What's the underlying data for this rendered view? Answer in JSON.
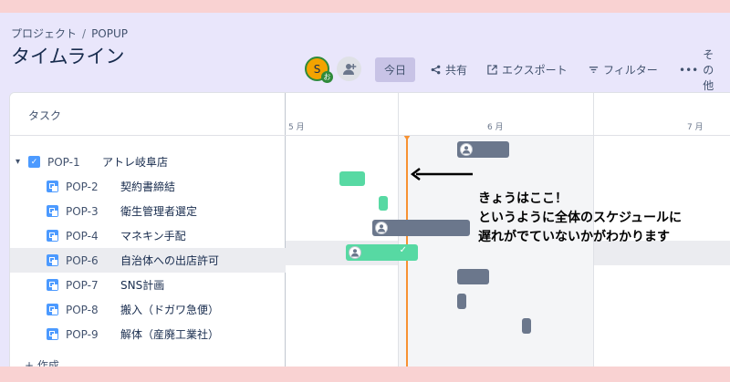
{
  "breadcrumb": {
    "project": "プロジェクト",
    "separator": "/",
    "current": "POPUP"
  },
  "page_title": "タイムライン",
  "avatar": {
    "initial": "S",
    "badge": "お"
  },
  "toolbar": {
    "today": "今日",
    "share": "共有",
    "export": "エクスポート",
    "filter": "フィルター",
    "more": "その他"
  },
  "task_header": "タスク",
  "months": [
    "5 月",
    "6 月",
    "7 月"
  ],
  "rows": [
    {
      "key": "POP-1",
      "summary": "アトレ岐阜店"
    },
    {
      "key": "POP-2",
      "summary": "契約書締結"
    },
    {
      "key": "POP-3",
      "summary": "衛生管理者選定"
    },
    {
      "key": "POP-4",
      "summary": "マネキン手配"
    },
    {
      "key": "POP-6",
      "summary": "自治体への出店許可"
    },
    {
      "key": "POP-7",
      "summary": "SNS計画"
    },
    {
      "key": "POP-8",
      "summary": "搬入（ドガワ急便）"
    },
    {
      "key": "POP-9",
      "summary": "解体（産廃工業社）"
    }
  ],
  "create_label": "+ 作成",
  "annotation": {
    "line1": "きょうはここ！",
    "line2": "というように全体のスケジュールに",
    "line3": "遅れがでていないかがわかります"
  },
  "colors": {
    "accent": "#4c9aff",
    "today": "#f79232",
    "bar_gray": "#6b778c",
    "bar_green": "#57d9a3"
  }
}
